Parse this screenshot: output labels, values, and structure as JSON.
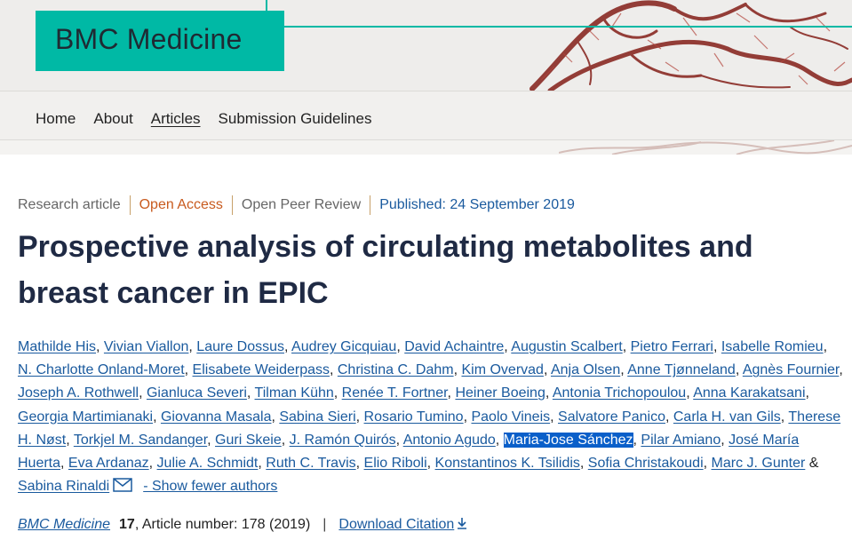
{
  "brand": {
    "title": "BMC Medicine"
  },
  "nav": {
    "items": [
      "Home",
      "About",
      "Articles",
      "Submission Guidelines"
    ],
    "active": "Articles"
  },
  "meta": {
    "type": "Research article",
    "access": "Open Access",
    "review": "Open Peer Review",
    "published": "Published: 24 September 2019"
  },
  "article": {
    "title": "Prospective analysis of circulating metabolites and breast cancer in EPIC"
  },
  "authors": [
    "Mathilde His",
    "Vivian Viallon",
    "Laure Dossus",
    "Audrey Gicquiau",
    "David Achaintre",
    "Augustin Scalbert",
    "Pietro Ferrari",
    "Isabelle Romieu",
    "N. Charlotte Onland-Moret",
    "Elisabete Weiderpass",
    "Christina C. Dahm",
    "Kim Overvad",
    "Anja Olsen",
    "Anne Tjønneland",
    "Agnès Fournier",
    "Joseph A. Rothwell",
    "Gianluca Severi",
    "Tilman Kühn",
    "Renée T. Fortner",
    "Heiner Boeing",
    "Antonia Trichopoulou",
    "Anna Karakatsani",
    "Georgia Martimianaki",
    "Giovanna Masala",
    "Sabina Sieri",
    "Rosario Tumino",
    "Paolo Vineis",
    "Salvatore Panico",
    "Carla H. van Gils",
    "Therese H. Nøst",
    "Torkjel M. Sandanger",
    "Guri Skeie",
    "J. Ramón Quirós",
    "Antonio Agudo",
    "Maria-Jose Sánchez",
    "Pilar Amiano",
    "José María Huerta",
    "Eva Ardanaz",
    "Julie A. Schmidt",
    "Ruth C. Travis",
    "Elio Riboli",
    "Konstantinos K. Tsilidis",
    "Sofia Christakoudi",
    "Marc J. Gunter",
    "Sabina Rinaldi"
  ],
  "authors_selected": "Maria-Jose Sánchez",
  "authors_conjunction": "&",
  "show_fewer": "- Show fewer authors",
  "citation": {
    "journal": "BMC Medicine",
    "volume": "17",
    "article_number": ", Article number: 178 (2019)",
    "separator": "|",
    "download": "Download Citation"
  },
  "colors": {
    "brand_teal": "#00b9a5",
    "link": "#1a5a9e",
    "open_access": "#c85a1e",
    "selection": "#0a5fc9"
  }
}
